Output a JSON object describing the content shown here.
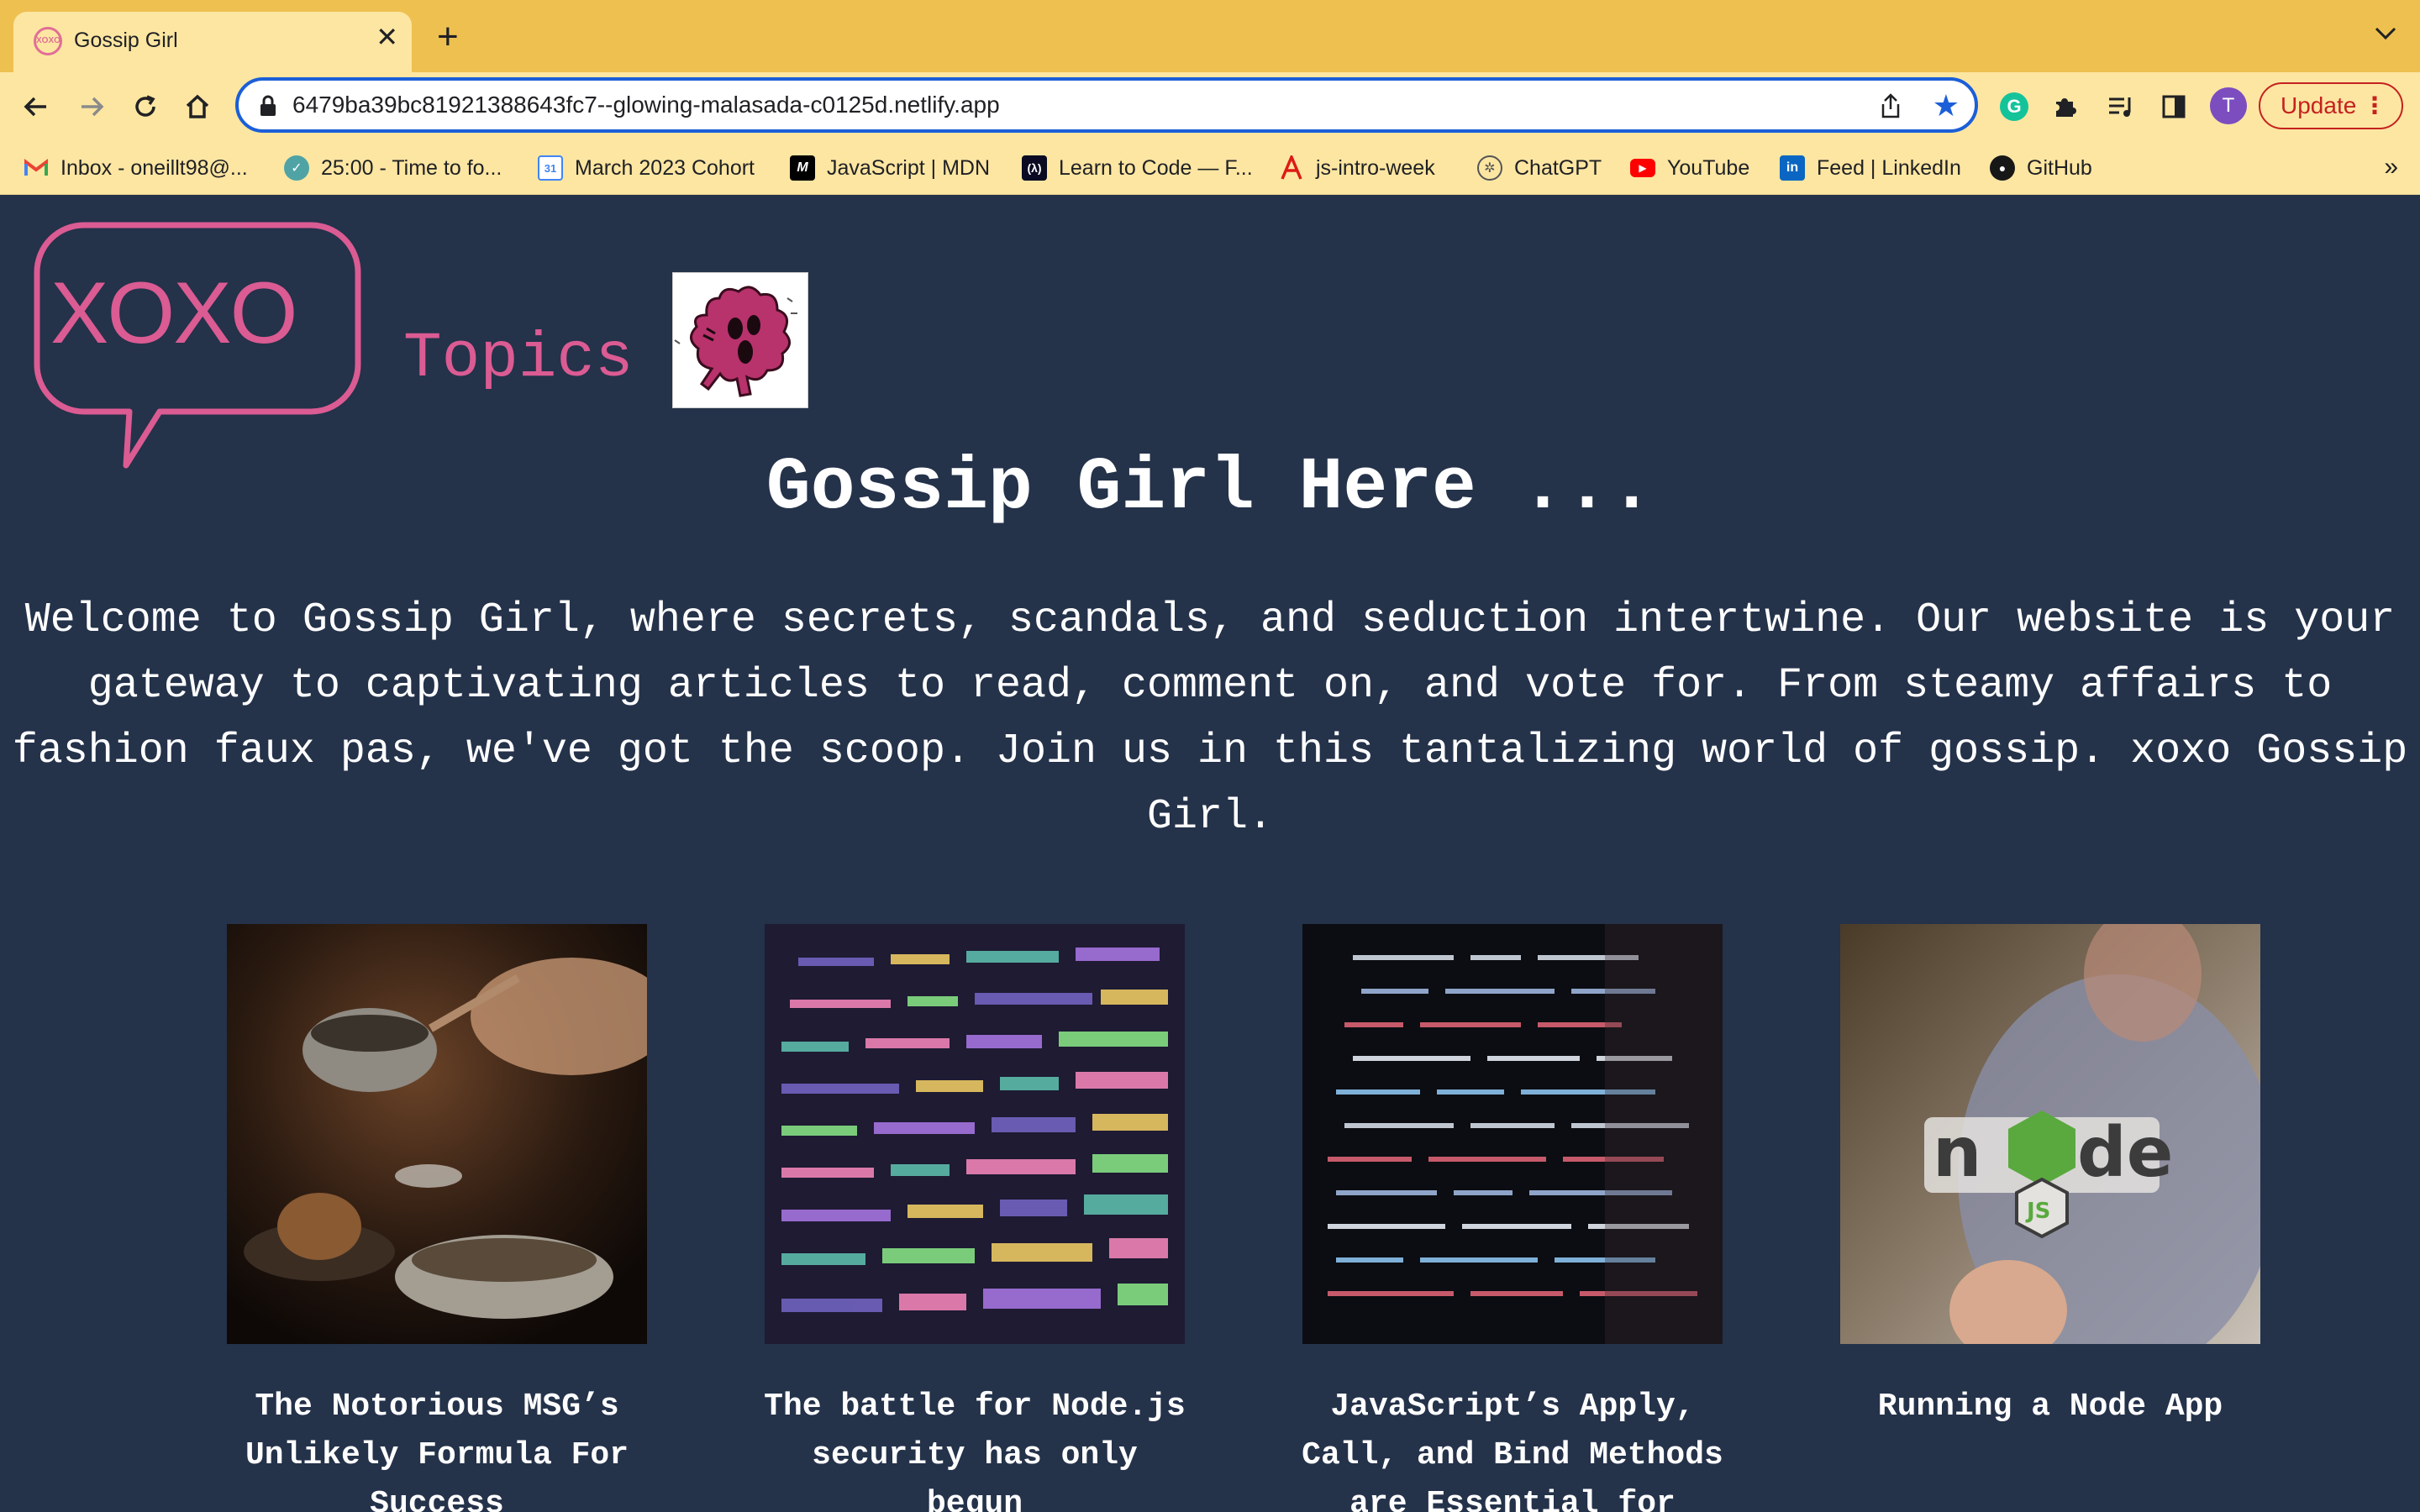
{
  "browser": {
    "tab_title": "Gossip Girl",
    "tab_favicon_text": "XOXO",
    "url": "6479ba39bc81921388643fc7--glowing-malasada-c0125d.netlify.app",
    "profile_initial": "T",
    "update_label": "Update",
    "bookmarks": [
      {
        "label": "Inbox - oneillt98@...",
        "icon": "gmail-icon",
        "color": "#ea4335"
      },
      {
        "label": "25:00 - Time to fo...",
        "icon": "check-circle-icon",
        "color": "#4fa3a5"
      },
      {
        "label": "March 2023 Cohort",
        "icon": "calendar-icon",
        "color": "#4285f4"
      },
      {
        "label": "JavaScript | MDN",
        "icon": "mdn-icon",
        "color": "#000000"
      },
      {
        "label": "Learn to Code — F...",
        "icon": "freecodecamp-icon",
        "color": "#0a0a23"
      },
      {
        "label": "js-intro-week",
        "icon": "angular-icon",
        "color": "#dd1b16"
      },
      {
        "label": "ChatGPT",
        "icon": "openai-icon",
        "color": "#10a37f"
      },
      {
        "label": "YouTube",
        "icon": "youtube-icon",
        "color": "#ff0000"
      },
      {
        "label": "Feed | LinkedIn",
        "icon": "linkedin-icon",
        "color": "#0a66c2"
      },
      {
        "label": "GitHub",
        "icon": "github-icon",
        "color": "#181717"
      }
    ]
  },
  "header": {
    "logo_text": "XOXO",
    "topics_label": "Topics",
    "mascot_icon": "pink-monster-icon"
  },
  "hero": {
    "title": "Gossip Girl Here ...",
    "intro": "Welcome to Gossip Girl, where secrets, scandals, and seduction intertwine. Our website is your gateway to captivating articles to read, comment on, and vote for. From steamy affairs to fashion faux pas, we've got the scoop. Join us in this tantalizing world of gossip. xoxo Gossip Girl."
  },
  "articles": [
    {
      "title": "The Notorious MSG’s Unlikely Formula For Success",
      "image": "cooking-photo"
    },
    {
      "title": "The battle for Node.js security has only begun",
      "image": "code-screen-photo"
    },
    {
      "title": "JavaScript’s Apply, Call, and Bind Methods are Essential for",
      "image": "dark-code-photo"
    },
    {
      "title": "Running a Node App",
      "image": "nodejs-sticker-photo"
    }
  ],
  "colors": {
    "background": "#24324a",
    "accent_pink": "#db5b93",
    "chrome_yellow": "#eec050",
    "chrome_light": "#fde6a2"
  }
}
